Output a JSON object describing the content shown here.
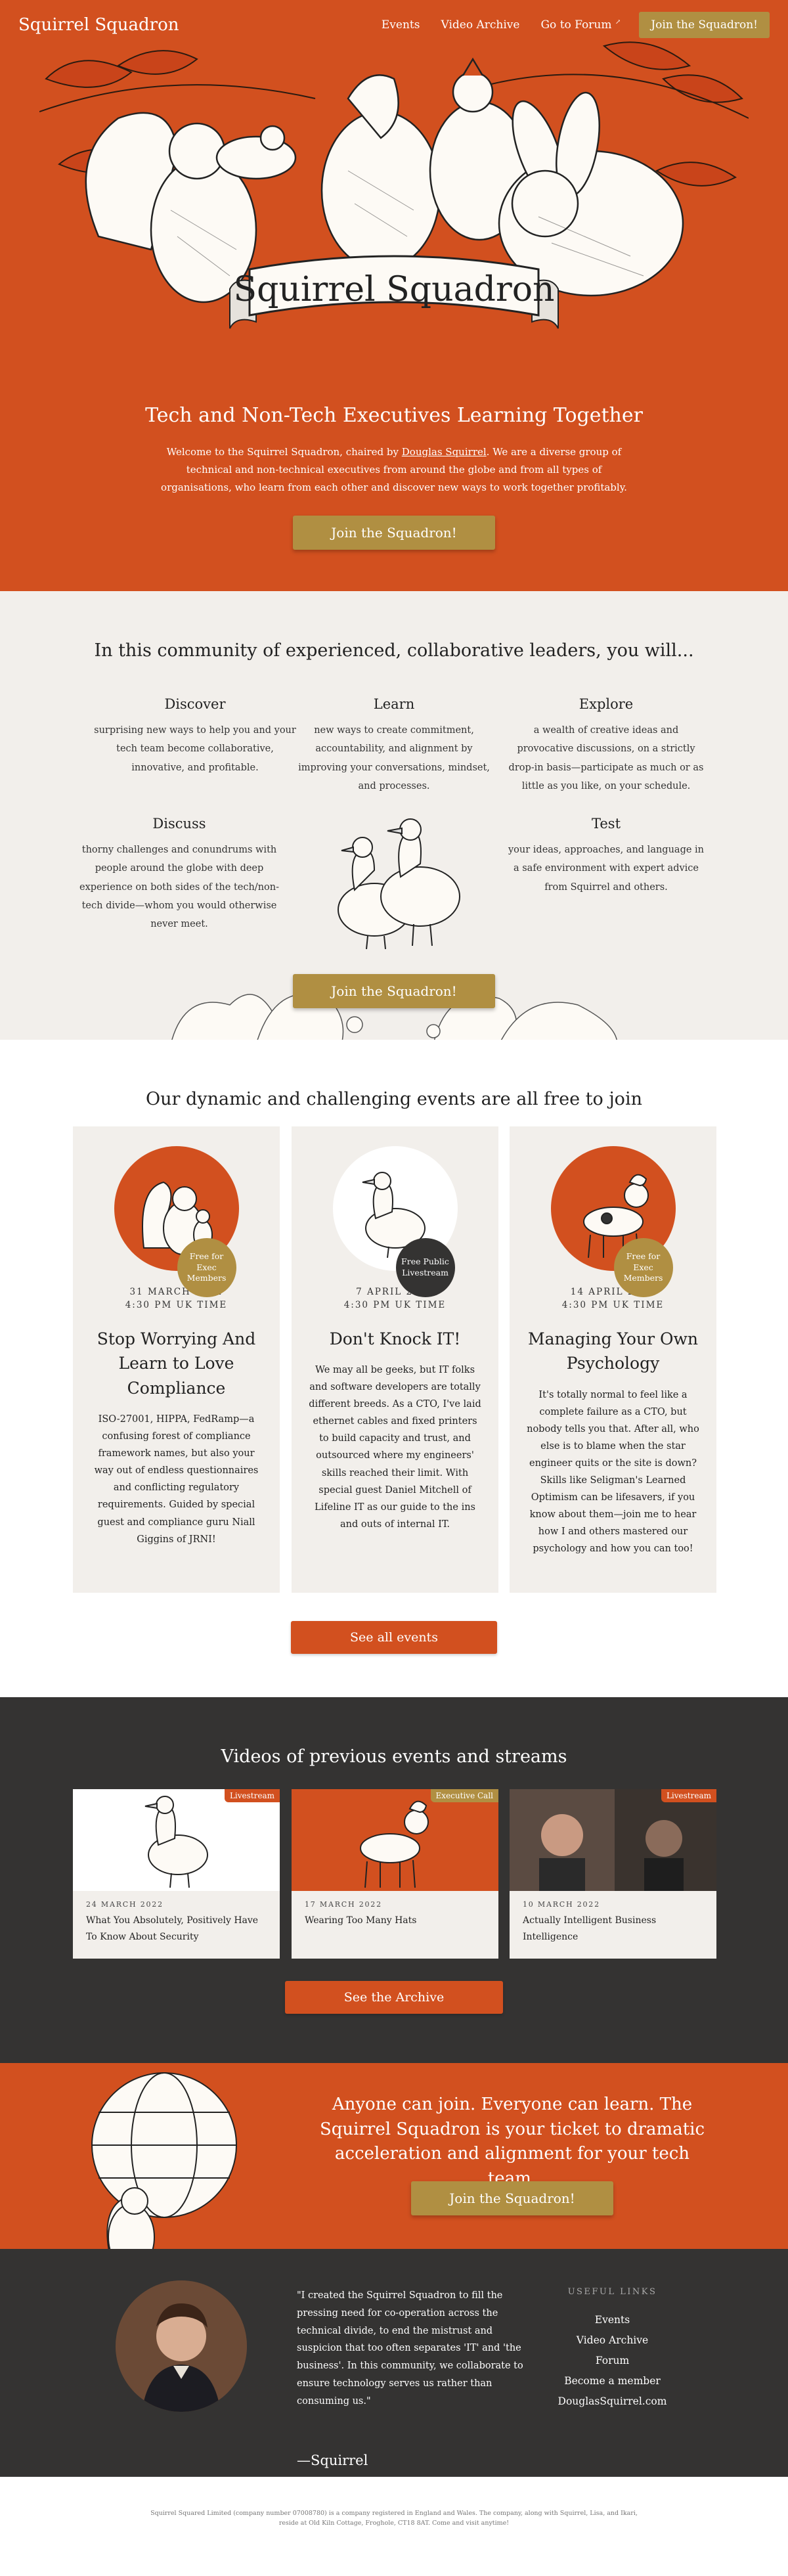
{
  "nav": {
    "brand": "Squirrel Squadron",
    "links": [
      "Events",
      "Video Archive",
      "Go to Forum"
    ],
    "external_glyph": "↗",
    "join_label": "Join the Squadron!"
  },
  "hero": {
    "banner_text": "Squirrel Squadron",
    "heading": "Tech and Non-Tech Executives Learning Together",
    "intro_before": "Welcome to the Squirrel Squadron, chaired by ",
    "intro_link": "Douglas Squirrel",
    "intro_after": ". We are a diverse group of technical and non-technical executives from around the globe and from all types of organisations, who learn from each other and discover new ways to work together profitably.",
    "cta": "Join the Squadron!"
  },
  "community": {
    "heading": "In this community of experienced, collaborative leaders, you will...",
    "features": [
      {
        "title": "Discover",
        "text": "surprising new ways to help you and your tech team become collaborative, innovative, and profitable."
      },
      {
        "title": "Learn",
        "text": "new ways to create commitment, accountability, and alignment by improving your conversations, mindset, and processes."
      },
      {
        "title": "Explore",
        "text": "a wealth of creative ideas and provocative discussions, on a strictly drop-in basis—participate as much or as little as you like, on your schedule."
      },
      {
        "title": "Discuss",
        "text": "thorny challenges and conundrums with people around the globe with deep experience on both sides of the tech/non-tech divide—whom you would otherwise never meet."
      },
      {
        "title": "Test",
        "text": "your ideas, approaches, and language in a safe environment with expert advice from Squirrel and others."
      }
    ],
    "cta": "Join the Squadron!"
  },
  "events": {
    "heading": "Our dynamic and challenging events are all free to join",
    "cards": [
      {
        "badge": "Free for Exec Members",
        "date_line1": "31 MARCH 2022",
        "date_line2": "4:30 PM UK TIME",
        "title": "Stop Worrying And Learn to Love Compliance",
        "text": "ISO-27001, HIPPA, FedRamp—a confusing forest of compliance framework names, but also your way out of endless questionnaires and conflicting regulatory requirements. Guided by special guest and compliance guru Niall Giggins of JRNI!"
      },
      {
        "badge": "Free Public Livestream",
        "date_line1": "7 APRIL 2022",
        "date_line2": "4:30 PM UK TIME",
        "title": "Don't Knock IT!",
        "text": "We may all be geeks, but IT folks and software developers are totally different breeds. As a CTO, I've laid ethernet cables and fixed printers to build capacity and trust, and outsourced where my engineers' skills reached their limit. With special guest Daniel Mitchell of Lifeline IT as our guide to the ins and outs of internal IT."
      },
      {
        "badge": "Free for Exec Members",
        "date_line1": "14 APRIL 2022",
        "date_line2": "4:30 PM UK TIME",
        "title": "Managing Your Own Psychology",
        "text": "It's totally normal to feel like a complete failure as a CTO, but nobody tells you that. After all, who else is to blame when the star engineer quits or the site is down? Skills like Seligman's Learned Optimism can be lifesavers, if you know about them—join me to hear how I and others mastered our psychology and how you can too!"
      }
    ],
    "cta": "See all events"
  },
  "videos": {
    "heading": "Videos of previous events and streams",
    "cards": [
      {
        "tag": "Livestream",
        "date": "24 MARCH 2022",
        "title": "What You Absolutely, Positively Have To Know About Security"
      },
      {
        "tag": "Executive Call",
        "date": "17 MARCH 2022",
        "title": "Wearing Too Many Hats"
      },
      {
        "tag": "Livestream",
        "date": "10 MARCH 2022",
        "title": "Actually Intelligent Business Intelligence"
      }
    ],
    "cta": "See the Archive"
  },
  "joinband": {
    "heading": "Anyone can join. Everyone can learn. The Squirrel Squadron is your ticket to dramatic acceleration and alignment for your tech team.",
    "cta": "Join the Squadron!"
  },
  "footer": {
    "quote": "\"I created the Squirrel Squadron to fill the pressing need for co-operation across the technical divide, to end the mistrust and suspicion that too often separates 'IT' and 'the business'. In this community, we collaborate to ensure technology serves us rather than consuming us.\"",
    "signature": "—Squirrel",
    "links_heading": "USEFUL LINKS",
    "links": [
      "Events",
      "Video Archive",
      "Forum",
      "Become a member",
      "DouglasSquirrel.com"
    ]
  },
  "legal": "Squirrel Squared Limited (company number 07008780) is a company registered in England and Wales. The company, along with Squirrel, Lisa, and Ikari, reside at Old Kiln Cottage, Froghole, CT18 8AT. Come and visit anytime!",
  "colors": {
    "accent": "#d2501f",
    "gold": "#b08f42",
    "dark": "#343332",
    "cream": "#f2efeb"
  }
}
